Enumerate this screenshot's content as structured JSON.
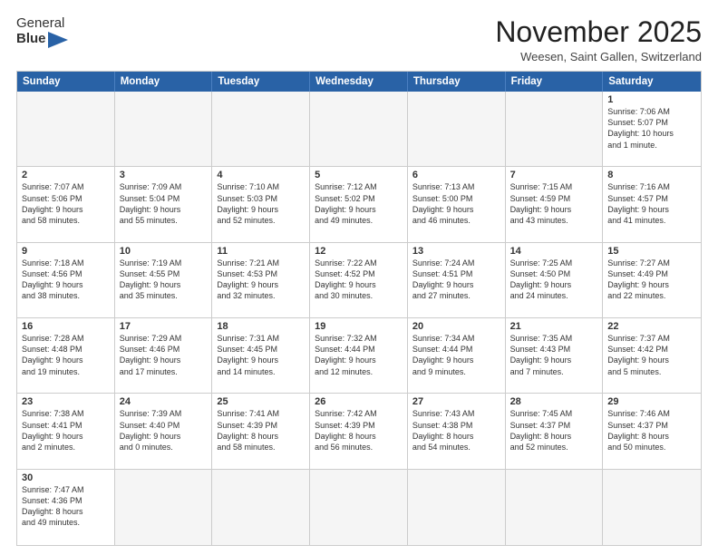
{
  "logo": {
    "line1": "General",
    "line2": "Blue"
  },
  "header": {
    "title": "November 2025",
    "subtitle": "Weesen, Saint Gallen, Switzerland"
  },
  "day_headers": [
    "Sunday",
    "Monday",
    "Tuesday",
    "Wednesday",
    "Thursday",
    "Friday",
    "Saturday"
  ],
  "weeks": [
    [
      {
        "day": "",
        "empty": true
      },
      {
        "day": "",
        "empty": true
      },
      {
        "day": "",
        "empty": true
      },
      {
        "day": "",
        "empty": true
      },
      {
        "day": "",
        "empty": true
      },
      {
        "day": "",
        "empty": true
      },
      {
        "day": "1",
        "content": "Sunrise: 7:06 AM\nSunset: 5:07 PM\nDaylight: 10 hours\nand 1 minute."
      }
    ],
    [
      {
        "day": "2",
        "content": "Sunrise: 7:07 AM\nSunset: 5:06 PM\nDaylight: 9 hours\nand 58 minutes."
      },
      {
        "day": "3",
        "content": "Sunrise: 7:09 AM\nSunset: 5:04 PM\nDaylight: 9 hours\nand 55 minutes."
      },
      {
        "day": "4",
        "content": "Sunrise: 7:10 AM\nSunset: 5:03 PM\nDaylight: 9 hours\nand 52 minutes."
      },
      {
        "day": "5",
        "content": "Sunrise: 7:12 AM\nSunset: 5:02 PM\nDaylight: 9 hours\nand 49 minutes."
      },
      {
        "day": "6",
        "content": "Sunrise: 7:13 AM\nSunset: 5:00 PM\nDaylight: 9 hours\nand 46 minutes."
      },
      {
        "day": "7",
        "content": "Sunrise: 7:15 AM\nSunset: 4:59 PM\nDaylight: 9 hours\nand 43 minutes."
      },
      {
        "day": "8",
        "content": "Sunrise: 7:16 AM\nSunset: 4:57 PM\nDaylight: 9 hours\nand 41 minutes."
      }
    ],
    [
      {
        "day": "9",
        "content": "Sunrise: 7:18 AM\nSunset: 4:56 PM\nDaylight: 9 hours\nand 38 minutes."
      },
      {
        "day": "10",
        "content": "Sunrise: 7:19 AM\nSunset: 4:55 PM\nDaylight: 9 hours\nand 35 minutes."
      },
      {
        "day": "11",
        "content": "Sunrise: 7:21 AM\nSunset: 4:53 PM\nDaylight: 9 hours\nand 32 minutes."
      },
      {
        "day": "12",
        "content": "Sunrise: 7:22 AM\nSunset: 4:52 PM\nDaylight: 9 hours\nand 30 minutes."
      },
      {
        "day": "13",
        "content": "Sunrise: 7:24 AM\nSunset: 4:51 PM\nDaylight: 9 hours\nand 27 minutes."
      },
      {
        "day": "14",
        "content": "Sunrise: 7:25 AM\nSunset: 4:50 PM\nDaylight: 9 hours\nand 24 minutes."
      },
      {
        "day": "15",
        "content": "Sunrise: 7:27 AM\nSunset: 4:49 PM\nDaylight: 9 hours\nand 22 minutes."
      }
    ],
    [
      {
        "day": "16",
        "content": "Sunrise: 7:28 AM\nSunset: 4:48 PM\nDaylight: 9 hours\nand 19 minutes."
      },
      {
        "day": "17",
        "content": "Sunrise: 7:29 AM\nSunset: 4:46 PM\nDaylight: 9 hours\nand 17 minutes."
      },
      {
        "day": "18",
        "content": "Sunrise: 7:31 AM\nSunset: 4:45 PM\nDaylight: 9 hours\nand 14 minutes."
      },
      {
        "day": "19",
        "content": "Sunrise: 7:32 AM\nSunset: 4:44 PM\nDaylight: 9 hours\nand 12 minutes."
      },
      {
        "day": "20",
        "content": "Sunrise: 7:34 AM\nSunset: 4:44 PM\nDaylight: 9 hours\nand 9 minutes."
      },
      {
        "day": "21",
        "content": "Sunrise: 7:35 AM\nSunset: 4:43 PM\nDaylight: 9 hours\nand 7 minutes."
      },
      {
        "day": "22",
        "content": "Sunrise: 7:37 AM\nSunset: 4:42 PM\nDaylight: 9 hours\nand 5 minutes."
      }
    ],
    [
      {
        "day": "23",
        "content": "Sunrise: 7:38 AM\nSunset: 4:41 PM\nDaylight: 9 hours\nand 2 minutes."
      },
      {
        "day": "24",
        "content": "Sunrise: 7:39 AM\nSunset: 4:40 PM\nDaylight: 9 hours\nand 0 minutes."
      },
      {
        "day": "25",
        "content": "Sunrise: 7:41 AM\nSunset: 4:39 PM\nDaylight: 8 hours\nand 58 minutes."
      },
      {
        "day": "26",
        "content": "Sunrise: 7:42 AM\nSunset: 4:39 PM\nDaylight: 8 hours\nand 56 minutes."
      },
      {
        "day": "27",
        "content": "Sunrise: 7:43 AM\nSunset: 4:38 PM\nDaylight: 8 hours\nand 54 minutes."
      },
      {
        "day": "28",
        "content": "Sunrise: 7:45 AM\nSunset: 4:37 PM\nDaylight: 8 hours\nand 52 minutes."
      },
      {
        "day": "29",
        "content": "Sunrise: 7:46 AM\nSunset: 4:37 PM\nDaylight: 8 hours\nand 50 minutes."
      }
    ],
    [
      {
        "day": "30",
        "content": "Sunrise: 7:47 AM\nSunset: 4:36 PM\nDaylight: 8 hours\nand 49 minutes."
      },
      {
        "day": "",
        "empty": true
      },
      {
        "day": "",
        "empty": true
      },
      {
        "day": "",
        "empty": true
      },
      {
        "day": "",
        "empty": true
      },
      {
        "day": "",
        "empty": true
      },
      {
        "day": "",
        "empty": true
      }
    ]
  ]
}
